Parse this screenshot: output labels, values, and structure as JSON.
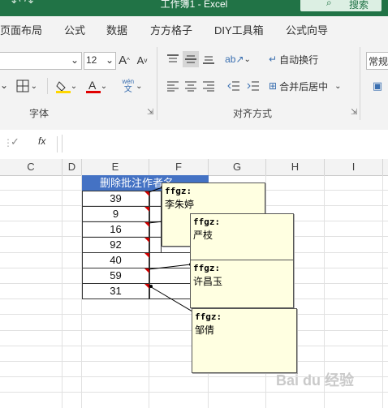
{
  "titlebar": {
    "title": "工作簿1  -  Excel",
    "search_label": "搜索",
    "search_icon": "search-icon"
  },
  "tabs": [
    "页面布局",
    "公式",
    "数据",
    "方方格子",
    "DIY工具箱",
    "公式向导"
  ],
  "ribbon": {
    "font_size": "12",
    "font_grow": "A",
    "font_shrink": "A",
    "wrap_text": "自动换行",
    "merge_center": "合并后居中",
    "number_format": "常规",
    "pinyin_top": "wén",
    "pinyin_bottom": "文",
    "group_font": "字体",
    "group_align": "对齐方式",
    "font_color": "#e00000",
    "highlight_color": "#ffd700"
  },
  "formula_bar": {
    "cancel": "✓",
    "fx": "fx",
    "value": ""
  },
  "columns": [
    "C",
    "D",
    "E",
    "F",
    "G",
    "H",
    "I"
  ],
  "sheet": {
    "header_cell": "删除批注作者名",
    "header_fill": "#4472c4",
    "values": [
      "39",
      "9",
      "16",
      "92",
      "40",
      "59",
      "31"
    ]
  },
  "comments": [
    {
      "author": "ffgz:",
      "text": "李朱婷"
    },
    {
      "author": "ffgz:",
      "text": "严枝"
    },
    {
      "author": "ffgz:",
      "text": "许昌玉"
    },
    {
      "author": "ffgz:",
      "text": "邹倩"
    }
  ],
  "watermark": "Bai du 经验"
}
